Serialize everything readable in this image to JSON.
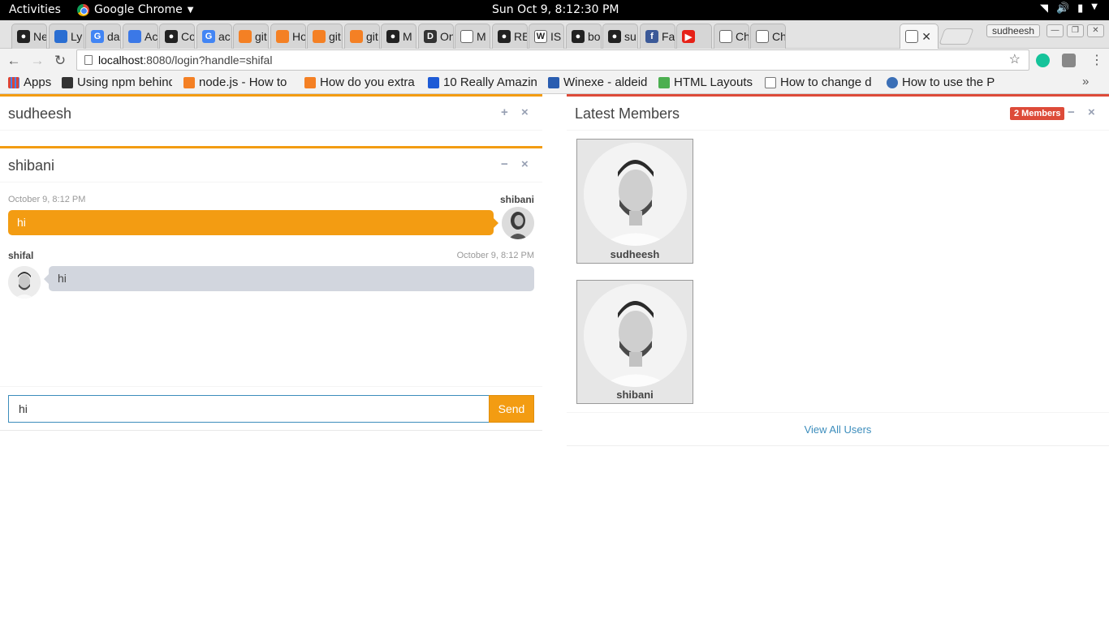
{
  "system_bar": {
    "activities": "Activities",
    "app_name": "Google Chrome",
    "clock": "Sun Oct  9,  8:12:30 PM"
  },
  "tabs": [
    {
      "label": "Ne",
      "favicon": "github-icon"
    },
    {
      "label": "Ly",
      "favicon": "bookmark-icon"
    },
    {
      "label": "da",
      "favicon": "google-icon"
    },
    {
      "label": "Ac",
      "favicon": "contacts-icon"
    },
    {
      "label": "Co",
      "favicon": "github-icon"
    },
    {
      "label": "ac",
      "favicon": "google-icon"
    },
    {
      "label": "git",
      "favicon": "stackoverflow-icon"
    },
    {
      "label": "Ho",
      "favicon": "stackoverflow-icon"
    },
    {
      "label": "git",
      "favicon": "stackoverflow-icon"
    },
    {
      "label": "git",
      "favicon": "stackoverflow-icon"
    },
    {
      "label": "M",
      "favicon": "github-icon"
    },
    {
      "label": "On",
      "favicon": "d-icon"
    },
    {
      "label": "M",
      "favicon": "page-icon"
    },
    {
      "label": "RE",
      "favicon": "github-icon"
    },
    {
      "label": "IS",
      "favicon": "wikipedia-icon"
    },
    {
      "label": "bo",
      "favicon": "github-icon"
    },
    {
      "label": "su",
      "favicon": "github-icon"
    },
    {
      "label": "Fa",
      "favicon": "facebook-icon"
    },
    {
      "label": "",
      "favicon": "youtube-icon"
    },
    {
      "label": "Ch",
      "favicon": "page-icon"
    },
    {
      "label": "Ch",
      "favicon": "page-icon"
    },
    {
      "label": "",
      "favicon": "page-icon",
      "active": true
    }
  ],
  "profile_name": "sudheesh",
  "address_bar": {
    "host": "localhost",
    "rest": ":8080/login?handle=shifal"
  },
  "bookmarks": {
    "apps": "Apps",
    "items": [
      "Using npm behind",
      "node.js - How to",
      "How do you extra",
      "10 Really Amazin",
      "Winexe - aldeid",
      "HTML Layouts",
      "How to change d",
      "How to use the P"
    ],
    "more": "»"
  },
  "user_box": {
    "title": "sudheesh"
  },
  "chat_box": {
    "title": "shibani",
    "messages": [
      {
        "name": "shibani",
        "time": "October 9, 8:12 PM",
        "text": "hi",
        "side": "right"
      },
      {
        "name": "shifal",
        "time": "October 9, 8:12 PM",
        "text": "hi",
        "side": "left"
      }
    ],
    "input_value": "hi",
    "send_label": "Send"
  },
  "members_box": {
    "title": "Latest Members",
    "badge": "2 Members",
    "members": [
      {
        "name": "sudheesh"
      },
      {
        "name": "shibani"
      }
    ],
    "view_all": "View All Users"
  },
  "colors": {
    "warning": "#f39c12",
    "danger": "#dd4b39",
    "link": "#3c8dbc"
  }
}
